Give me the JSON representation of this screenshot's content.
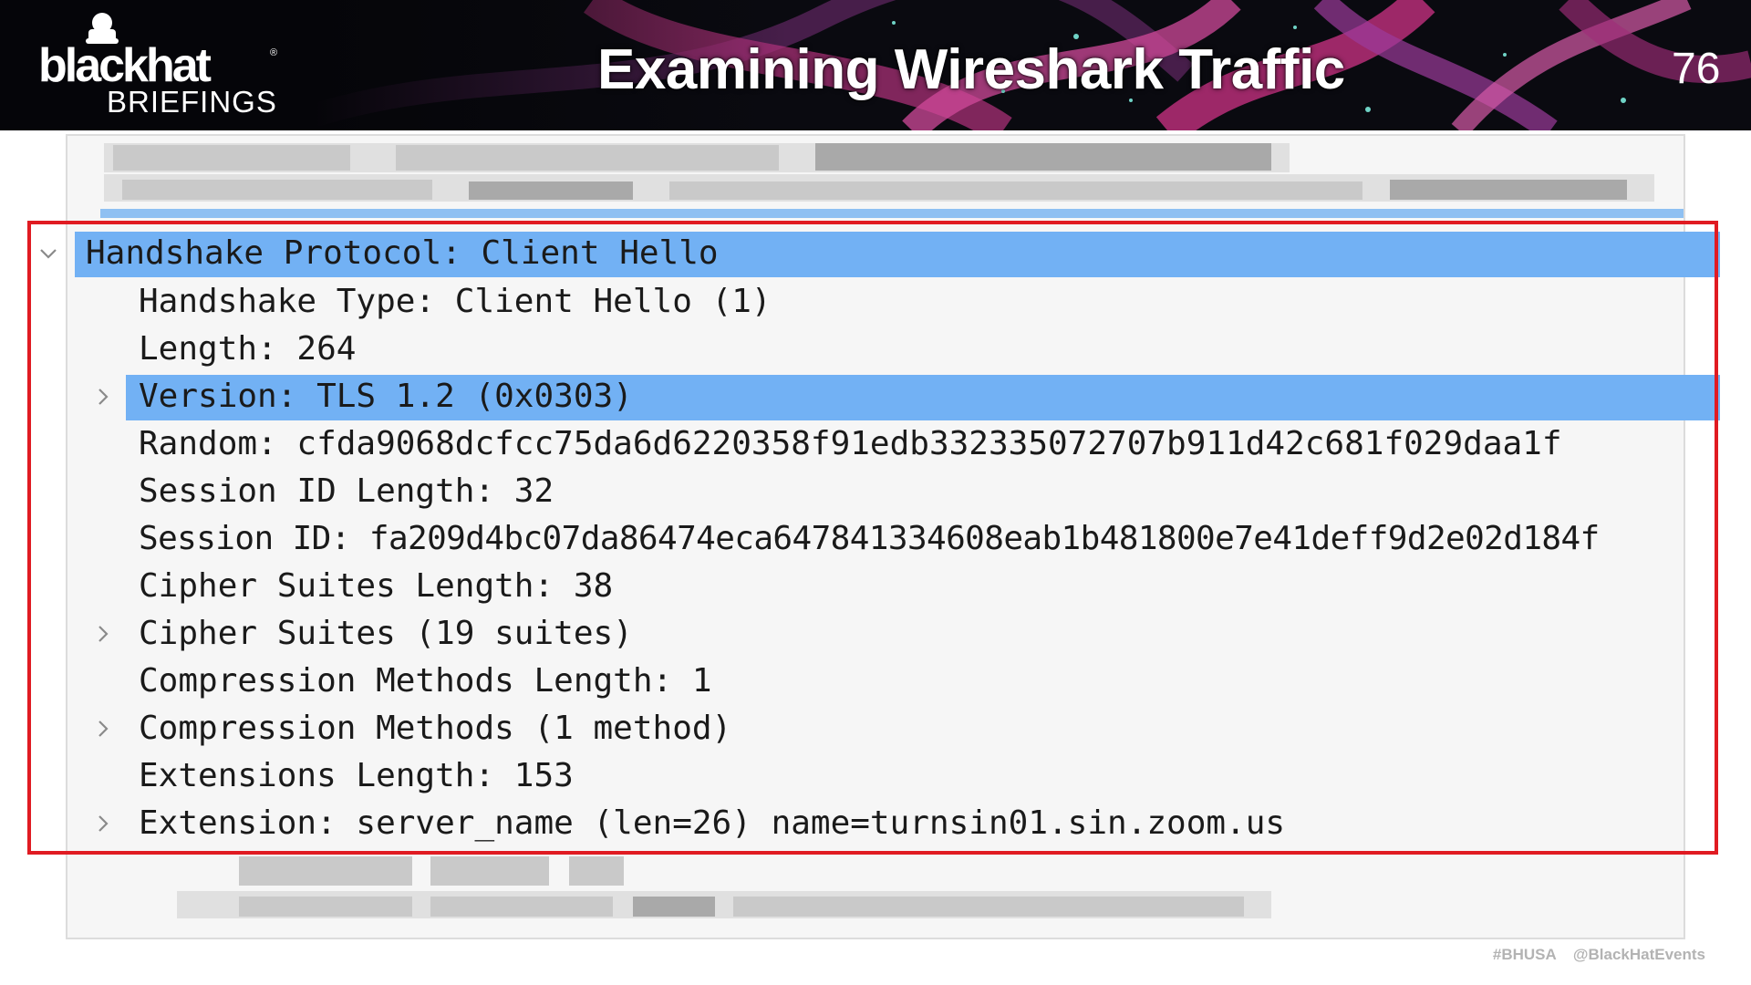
{
  "header": {
    "logo_main": "blackhat",
    "logo_sub": "BRIEFINGS",
    "logo_reg": "®",
    "title": "Examining Wireshark Traffic",
    "slide_number": "76"
  },
  "colors": {
    "selection": "#72b1f4",
    "highlight_border": "#e01b22",
    "header_bg": "#050509",
    "accent_magenta": "#c2307e"
  },
  "tree": {
    "rows": [
      {
        "text": "Handshake Protocol: Client Hello",
        "toggle": "chevron-down-icon",
        "selected": true
      },
      {
        "text": "Handshake Type: Client Hello (1)",
        "toggle": null,
        "selected": false
      },
      {
        "text": "Length: 264",
        "toggle": null,
        "selected": false
      },
      {
        "text": "Version: TLS 1.2 (0x0303)",
        "toggle": "chevron-right-icon",
        "selected": true
      },
      {
        "text": "Random: cfda9068dcfcc75da6d6220358f91edb332335072707b911d42c681f029daa1f",
        "toggle": null,
        "selected": false
      },
      {
        "text": "Session ID Length: 32",
        "toggle": null,
        "selected": false
      },
      {
        "text": "Session ID: fa209d4bc07da86474eca647841334608eab1b481800e7e41deff9d2e02d184f",
        "toggle": null,
        "selected": false
      },
      {
        "text": "Cipher Suites Length: 38",
        "toggle": null,
        "selected": false
      },
      {
        "text": "Cipher Suites (19 suites)",
        "toggle": "chevron-right-icon",
        "selected": false
      },
      {
        "text": "Compression Methods Length: 1",
        "toggle": null,
        "selected": false
      },
      {
        "text": "Compression Methods (1 method)",
        "toggle": "chevron-right-icon",
        "selected": false
      },
      {
        "text": "Extensions Length: 153",
        "toggle": null,
        "selected": false
      },
      {
        "text": "Extension: server_name (len=26) name=turnsin01.sin.zoom.us",
        "toggle": "chevron-right-icon",
        "selected": false
      }
    ]
  },
  "footer": {
    "hashtag": "#BHUSA",
    "handle": "@BlackHatEvents"
  }
}
